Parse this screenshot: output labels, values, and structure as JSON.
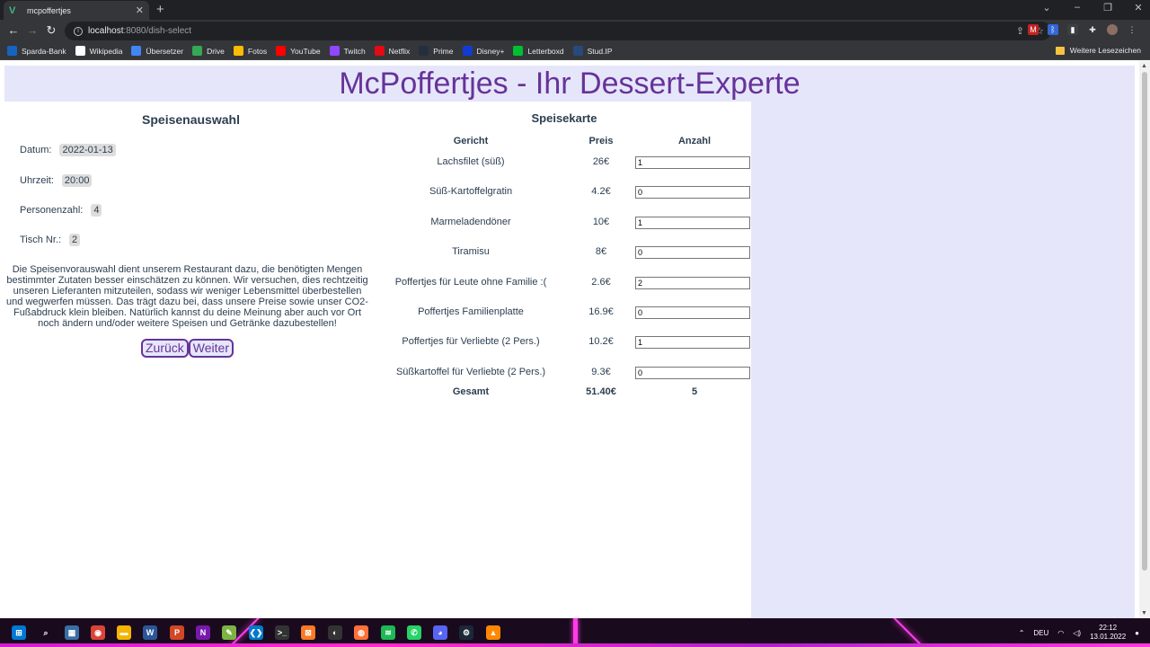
{
  "browser": {
    "tab_title": "mcpoffertjes",
    "url_host": "localhost",
    "url_path": ":8080/dish-select",
    "bookmarks": [
      {
        "label": "Sparda-Bank",
        "color": "#1565c0"
      },
      {
        "label": "Wikipedia",
        "color": "#ffffff"
      },
      {
        "label": "Übersetzer",
        "color": "#4285f4"
      },
      {
        "label": "Drive",
        "color": "#34a853"
      },
      {
        "label": "Fotos",
        "color": "#fbbc04"
      },
      {
        "label": "YouTube",
        "color": "#ff0000"
      },
      {
        "label": "Twitch",
        "color": "#9146ff"
      },
      {
        "label": "Netflix",
        "color": "#e50914"
      },
      {
        "label": "Prime",
        "color": "#232f3e"
      },
      {
        "label": "Disney+",
        "color": "#113ccf"
      },
      {
        "label": "Letterboxd",
        "color": "#00c030"
      },
      {
        "label": "Stud.IP",
        "color": "#28497c"
      }
    ],
    "other_bookmarks": "Weitere Lesezeichen"
  },
  "page": {
    "title": "McPoffertjes - Ihr Dessert-Experte",
    "left": {
      "heading": "Speisenauswahl",
      "date_label": "Datum:",
      "date_value": "2022-01-13",
      "time_label": "Uhrzeit:",
      "time_value": "20:00",
      "persons_label": "Personenzahl:",
      "persons_value": "4",
      "table_label": "Tisch Nr.:",
      "table_value": "2",
      "info": "Die Speisenvorauswahl dient unserem Restaurant dazu, die benötigten Mengen bestimmter Zutaten besser einschätzen zu können. Wir versuchen, dies rechtzeitig unseren Lieferanten mitzuteilen, sodass wir weniger Lebensmittel überbestellen und wegwerfen müssen. Das trägt dazu bei, dass unsere Preise sowie unser CO2-Fußabdruck klein bleiben. Natürlich kannst du deine Meinung aber auch vor Ort noch ändern und/oder weitere Speisen und Getränke dazubestellen!",
      "back_button": "Zurück",
      "next_button": "Weiter"
    },
    "menu": {
      "heading": "Speisekarte",
      "col_dish": "Gericht",
      "col_price": "Preis",
      "col_qty": "Anzahl",
      "rows": [
        {
          "dish": "Lachsfilet (süß)",
          "price": "26€",
          "qty": "1"
        },
        {
          "dish": "Süß-Kartoffelgratin",
          "price": "4.2€",
          "qty": "0"
        },
        {
          "dish": "Marmeladendöner",
          "price": "10€",
          "qty": "1"
        },
        {
          "dish": "Tiramisu",
          "price": "8€",
          "qty": "0"
        },
        {
          "dish": "Poffertjes für Leute ohne Familie :(",
          "price": "2.6€",
          "qty": "2"
        },
        {
          "dish": "Poffertjes Familienplatte",
          "price": "16.9€",
          "qty": "0"
        },
        {
          "dish": "Poffertjes für Verliebte (2 Pers.)",
          "price": "10.2€",
          "qty": "1"
        },
        {
          "dish": "Süßkartoffel für Verliebte (2 Pers.)",
          "price": "9.3€",
          "qty": "0"
        }
      ],
      "total_label": "Gesamt",
      "total_price": "51.40€",
      "total_qty": "5"
    }
  },
  "taskbar": {
    "language": "DEU",
    "time": "22:12",
    "date": "13.01.2022"
  }
}
